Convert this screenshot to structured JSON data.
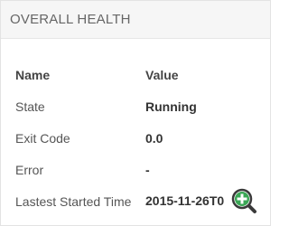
{
  "panel": {
    "title": "OVERALL HEALTH"
  },
  "table": {
    "headers": {
      "name": "Name",
      "value": "Value"
    },
    "rows": [
      {
        "name": "State",
        "value": "Running"
      },
      {
        "name": "Exit Code",
        "value": "0.0"
      },
      {
        "name": "Error",
        "value": "-"
      },
      {
        "name": "Lastest Started Time",
        "value": "2015-11-26T0"
      }
    ]
  },
  "zoom": {
    "icon": "zoom-in-icon",
    "accent_color": "#3aa655"
  }
}
